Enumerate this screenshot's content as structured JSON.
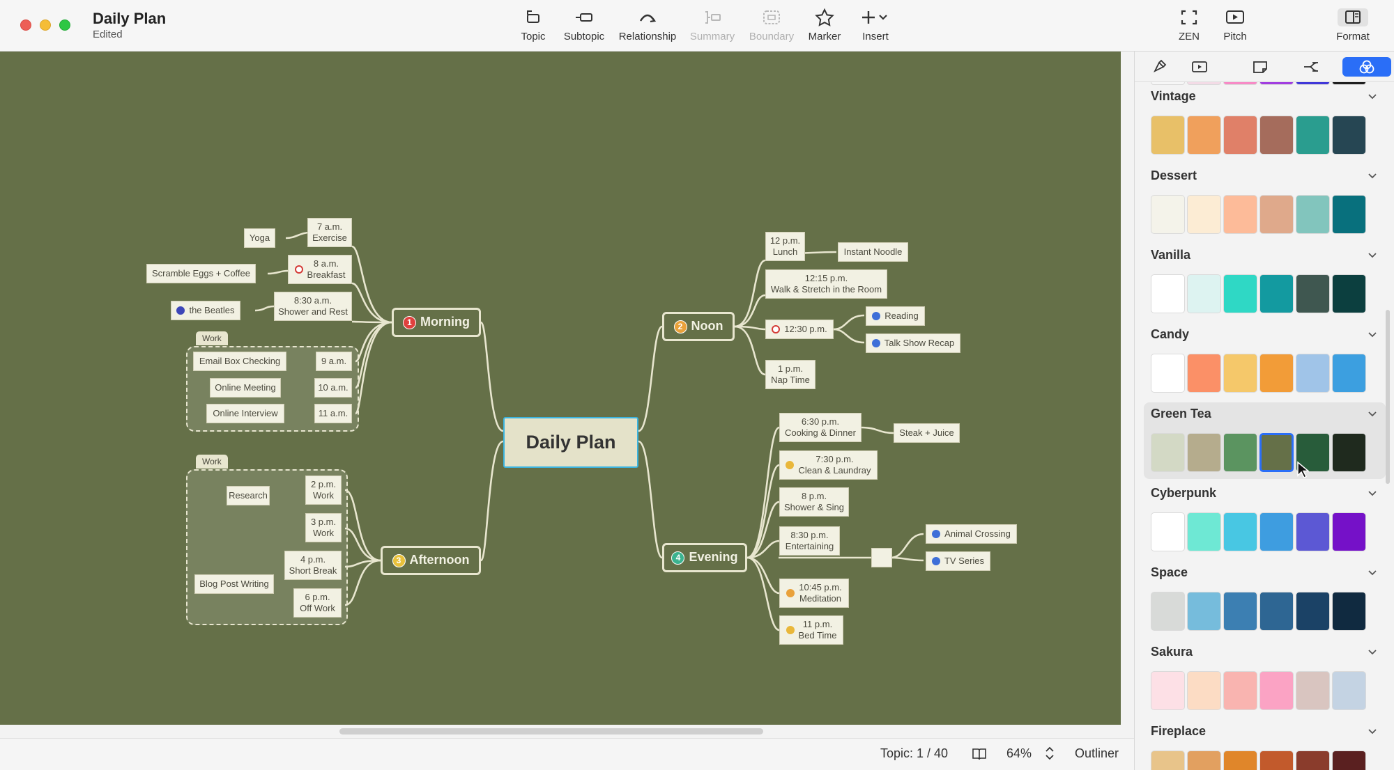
{
  "window": {
    "title": "Daily Plan",
    "subtitle": "Edited"
  },
  "toolbar": {
    "items": [
      {
        "label": "Topic",
        "icon": "topic-icon"
      },
      {
        "label": "Subtopic",
        "icon": "subtopic-icon"
      },
      {
        "label": "Relationship",
        "icon": "relationship-icon"
      },
      {
        "label": "Summary",
        "icon": "summary-icon",
        "disabled": true
      },
      {
        "label": "Boundary",
        "icon": "boundary-icon",
        "disabled": true
      },
      {
        "label": "Marker",
        "icon": "marker-icon"
      },
      {
        "label": "Insert",
        "icon": "insert-icon"
      }
    ],
    "right": [
      {
        "label": "ZEN",
        "icon": "zen-icon"
      },
      {
        "label": "Pitch",
        "icon": "pitch-icon"
      },
      {
        "label": "Format",
        "icon": "format-icon",
        "selected": true
      }
    ]
  },
  "map": {
    "root": "Daily Plan",
    "main_topics": [
      {
        "num": "1",
        "label": "Morning",
        "color": "#e0413e"
      },
      {
        "num": "2",
        "label": "Noon",
        "color": "#e9a13b"
      },
      {
        "num": "3",
        "label": "Afternoon",
        "color": "#e9c13b"
      },
      {
        "num": "4",
        "label": "Evening",
        "color": "#3bb38f"
      }
    ],
    "boundary_labels": [
      "Work",
      "Work"
    ],
    "morning": {
      "yoga": "Yoga",
      "exercise": [
        "7 a.m.",
        "Exercise"
      ],
      "eggs": "Scramble Eggs + Coffee",
      "breakfast": [
        "8 a.m.",
        "Breakfast"
      ],
      "beatles": "the Beatles",
      "shower": [
        "8:30 a.m.",
        "Shower and Rest"
      ],
      "email": "Email Box Checking",
      "t9": "9 a.m.",
      "meeting": "Online Meeting",
      "t10": "10 a.m.",
      "interview": "Online Interview",
      "t11": "11 a.m."
    },
    "afternoon": {
      "research": "Research",
      "w2": [
        "2 p.m.",
        "Work"
      ],
      "blog": "Blog Post Writing",
      "w3": [
        "3 p.m.",
        "Work"
      ],
      "brk": [
        "4 p.m.",
        "Short Break"
      ],
      "off": [
        "6 p.m.",
        "Off Work"
      ]
    },
    "noon": {
      "lunch": [
        "12 p.m.",
        "Lunch"
      ],
      "noodle": "Instant Noodle",
      "walk": [
        "12:15 p.m.",
        "Walk & Stretch in the Room"
      ],
      "t1230": "12:30 p.m.",
      "reading": "Reading",
      "talk": "Talk Show Recap",
      "nap": [
        "1 p.m.",
        "Nap Time"
      ]
    },
    "evening": {
      "cook": [
        "6:30 p.m.",
        "Cooking & Dinner"
      ],
      "steak": "Steak + Juice",
      "clean": [
        "7:30 p.m.",
        "Clean & Laundray"
      ],
      "sing": [
        "8 p.m.",
        "Shower & Sing"
      ],
      "ent": [
        "8:30 p.m.",
        "Entertaining"
      ],
      "animal": "Animal Crossing",
      "tv": "TV Series",
      "med": [
        "10:45 p.m.",
        "Meditation"
      ],
      "bed": [
        "11 p.m.",
        "Bed Time"
      ]
    }
  },
  "status": {
    "topic": "Topic: 1 / 40",
    "zoom": "64%",
    "outliner": "Outliner"
  },
  "themes": [
    {
      "name": "Vintage",
      "colors": [
        "#e8c068",
        "#f0a05c",
        "#e08068",
        "#a56c5c",
        "#2a9d8f",
        "#264653"
      ]
    },
    {
      "name": "Dessert",
      "colors": [
        "#f4f3ea",
        "#fcecd4",
        "#fdbb99",
        "#dfa98b",
        "#82c5bd",
        "#08707d"
      ]
    },
    {
      "name": "Vanilla",
      "colors": [
        "#ffffff",
        "#ddf3f1",
        "#2fd8c5",
        "#139aa0",
        "#3f5750",
        "#0c3f3f"
      ]
    },
    {
      "name": "Candy",
      "colors": [
        "#ffffff",
        "#fb9067",
        "#f5c86a",
        "#f29c38",
        "#a0c4e8",
        "#3c9fe0"
      ]
    },
    {
      "name": "Green Tea",
      "colors": [
        "#d3d9c5",
        "#b5ac8d",
        "#5b9460",
        "#657048",
        "#285c3a",
        "#1f2a1e"
      ],
      "selected_index": 3
    },
    {
      "name": "Cyberpunk",
      "colors": [
        "#ffffff",
        "#6ee8d4",
        "#48c7e3",
        "#3e9de0",
        "#5c58d4",
        "#7511c8"
      ]
    },
    {
      "name": "Space",
      "colors": [
        "#d8dad8",
        "#76bcdc",
        "#3c7fb2",
        "#2e6693",
        "#1b4266",
        "#102a40"
      ]
    },
    {
      "name": "Sakura",
      "colors": [
        "#fde0e6",
        "#fcdcc4",
        "#f9b4b0",
        "#fba3c4",
        "#d9c5c0",
        "#c4d3e3"
      ]
    },
    {
      "name": "Fireplace",
      "colors": [
        "#e8c48a",
        "#e2a060",
        "#e0862a",
        "#c25a2c",
        "#8a3c2c",
        "#5a2020"
      ]
    }
  ]
}
